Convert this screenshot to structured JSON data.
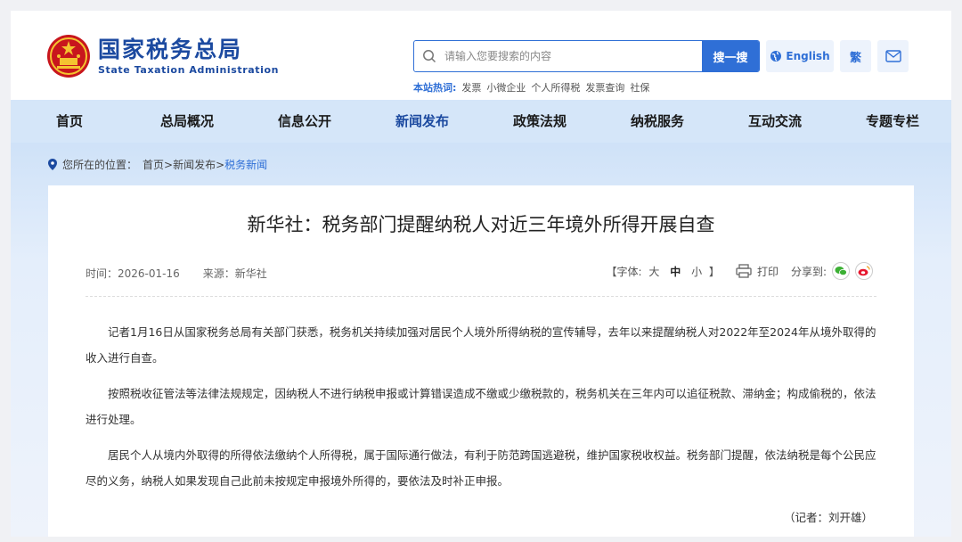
{
  "header": {
    "logo_cn": "国家税务总局",
    "logo_en": "State Taxation Administration",
    "search_placeholder": "请输入您要搜索的内容",
    "search_button": "搜一搜",
    "hot_label": "本站热词:",
    "hot_words": [
      "发票",
      "小微企业",
      "个人所得税",
      "发票查询",
      "社保"
    ],
    "english_label": "English",
    "traditional_label": "繁"
  },
  "nav": {
    "items": [
      "首页",
      "总局概况",
      "信息公开",
      "新闻发布",
      "政策法规",
      "纳税服务",
      "互动交流",
      "专题专栏"
    ],
    "active": "新闻发布"
  },
  "breadcrumb": {
    "prefix": "您所在的位置：",
    "path": "首页>新闻发布>",
    "current": "税务新闻"
  },
  "article": {
    "title": "新华社：税务部门提醒纳税人对近三年境外所得开展自查",
    "time": "时间：2026-01-16",
    "source": "来源：新华社",
    "font_label_open": "【字体:",
    "font_large": "大",
    "font_medium": "中",
    "font_small": "小",
    "font_label_close": "】",
    "print_label": "打印",
    "share_label": "分享到:",
    "paragraphs": [
      "记者1月16日从国家税务总局有关部门获悉，税务机关持续加强对居民个人境外所得纳税的宣传辅导，去年以来提醒纳税人对2022年至2024年从境外取得的收入进行自查。",
      "按照税收征管法等法律法规规定，因纳税人不进行纳税申报或计算错误造成不缴或少缴税款的，税务机关在三年内可以追征税款、滞纳金；构成偷税的，依法进行处理。",
      "居民个人从境内外取得的所得依法缴纳个人所得税，属于国际通行做法，有利于防范跨国逃避税，维护国家税收权益。税务部门提醒，依法纳税是每个公民应尽的义务，纳税人如果发现自己此前未按规定申报境外所得的，要依法及时补正申报。"
    ],
    "author": "（记者：刘开雄）"
  },
  "colors": {
    "brand": "#1c4aa0",
    "accent": "#2f6fd6",
    "nav_bg": "#d5e6f9"
  }
}
